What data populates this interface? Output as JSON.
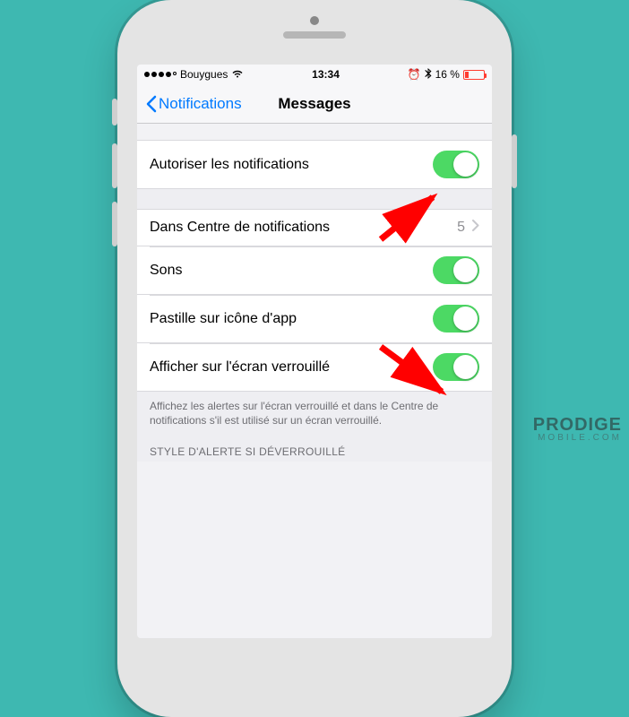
{
  "statusbar": {
    "carrier": "Bouygues",
    "time": "13:34",
    "battery_pct": "16 %"
  },
  "navbar": {
    "back_label": "Notifications",
    "title": "Messages"
  },
  "rows": {
    "allow": "Autoriser les notifications",
    "center": "Dans Centre de notifications",
    "center_value": "5",
    "sounds": "Sons",
    "badge": "Pastille sur icône d'app",
    "lockscreen": "Afficher sur l'écran verrouillé"
  },
  "footer": "Affichez les alertes sur l'écran verrouillé et dans le Centre de notifications s'il est utilisé sur un écran verrouillé.",
  "section_header": "STYLE D'ALERTE SI DÉVERROUILLÉ",
  "watermark": {
    "line1": "PRODIGE",
    "line2": "MOBILE.COM"
  }
}
